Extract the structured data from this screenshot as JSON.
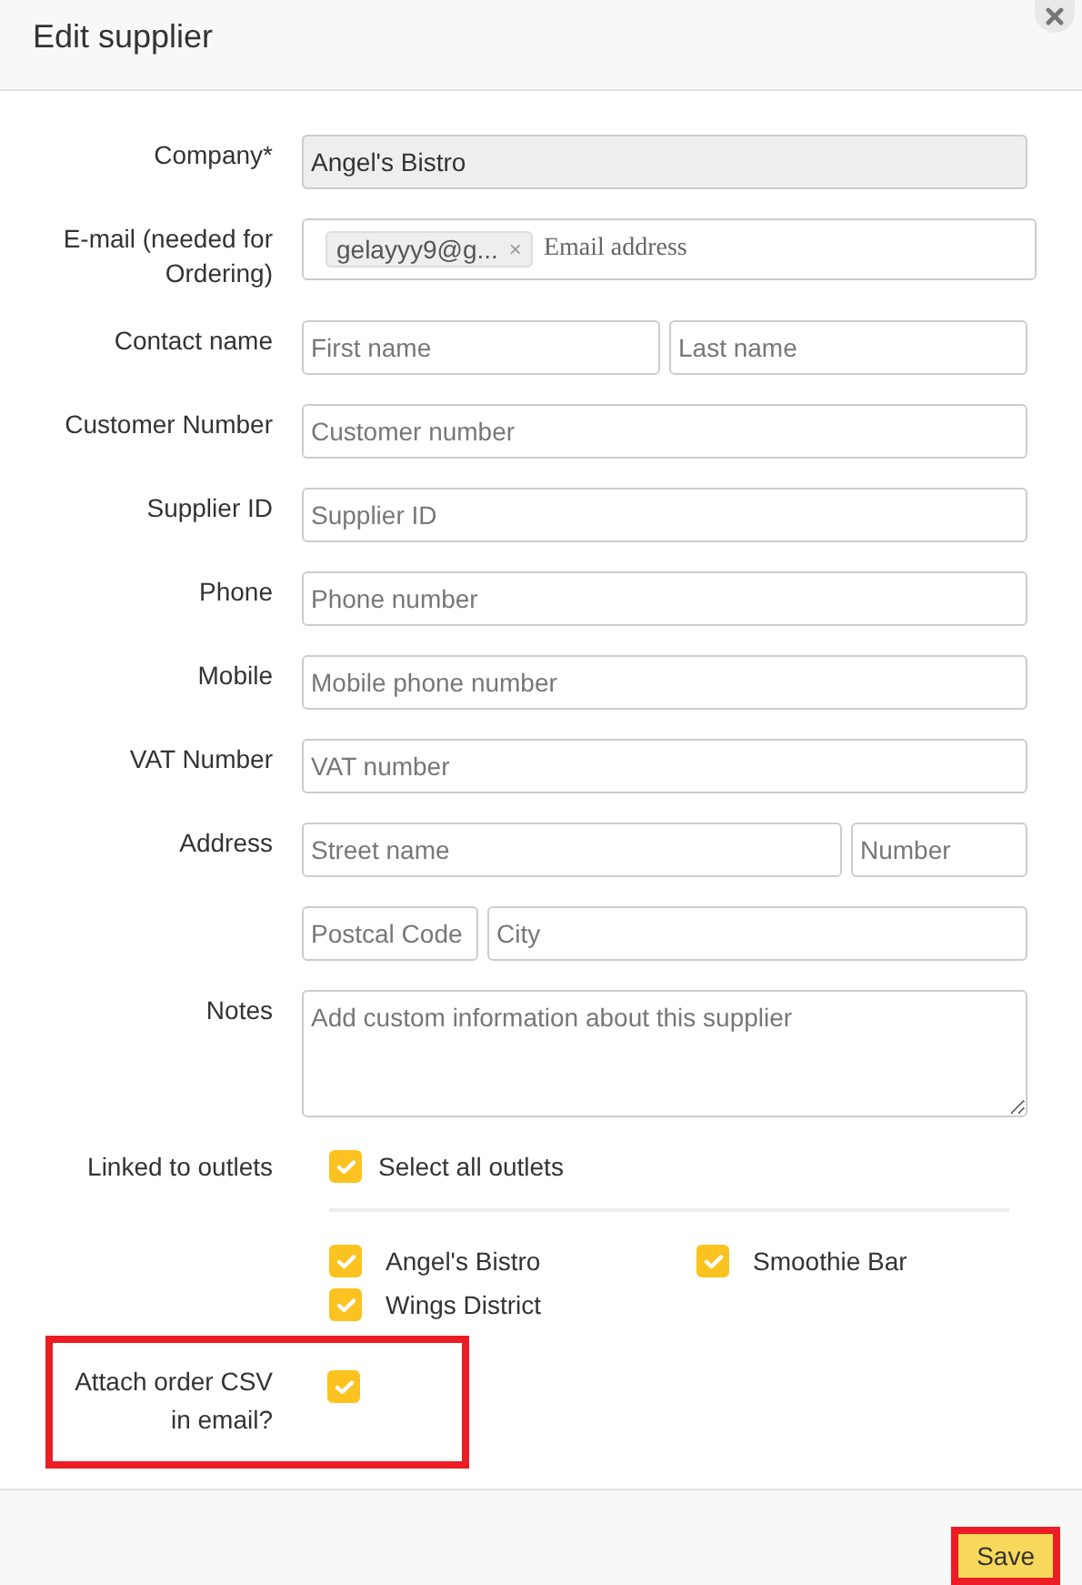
{
  "title": "Edit supplier",
  "rows": [
    {
      "label": "Company*",
      "kind": "text",
      "inputs": [
        {
          "value": "Angel's Bistro",
          "disabled": true
        }
      ]
    },
    {
      "label": "E-mail (needed for Ordering)",
      "kind": "tags",
      "tags": [
        {
          "text": "gelayyy9@g...",
          "remove": "×"
        }
      ],
      "placeholder": "Email address"
    },
    {
      "label": "Contact name",
      "kind": "text",
      "inputs": [
        {
          "placeholder": "First name",
          "disabled": false
        },
        {
          "placeholder": "Last name",
          "disabled": false
        }
      ]
    },
    {
      "label": "Customer Number",
      "kind": "text",
      "inputs": [
        {
          "placeholder": "Customer number",
          "disabled": false
        }
      ]
    },
    {
      "label": "Supplier ID",
      "kind": "text",
      "inputs": [
        {
          "placeholder": "Supplier ID",
          "disabled": false
        }
      ]
    },
    {
      "label": "Phone",
      "kind": "text",
      "inputs": [
        {
          "placeholder": "Phone number",
          "disabled": false
        }
      ]
    },
    {
      "label": "Mobile",
      "kind": "text",
      "inputs": [
        {
          "placeholder": "Mobile phone number",
          "disabled": false
        }
      ]
    },
    {
      "label": "VAT Number",
      "kind": "text",
      "inputs": [
        {
          "placeholder": "VAT number",
          "disabled": false
        }
      ]
    },
    {
      "label": "Address",
      "kind": "text",
      "inputs": [
        {
          "placeholder": "Street name",
          "disabled": false
        },
        {
          "placeholder": "Number",
          "disabled": false
        }
      ]
    },
    {
      "kind": "text",
      "inputs": [
        {
          "placeholder": "Postcal Code",
          "disabled": false
        },
        {
          "placeholder": "City",
          "disabled": false
        }
      ]
    },
    {
      "label": "Notes",
      "kind": "textarea",
      "placeholder": "Add custom information about this supplier"
    }
  ],
  "outlets": {
    "label": "Linked to outlets",
    "select_all": {
      "label": "Select all outlets",
      "checked": true
    },
    "items": [
      {
        "label": "Angel's Bistro",
        "checked": true
      },
      {
        "label": "Smoothie Bar",
        "checked": true
      },
      {
        "label": "Wings District",
        "checked": true
      }
    ]
  },
  "attach_csv": {
    "label": "Attach order CSV in email?",
    "checked": true,
    "highlighted": true
  },
  "save": {
    "label": "Save",
    "highlighted": true
  }
}
